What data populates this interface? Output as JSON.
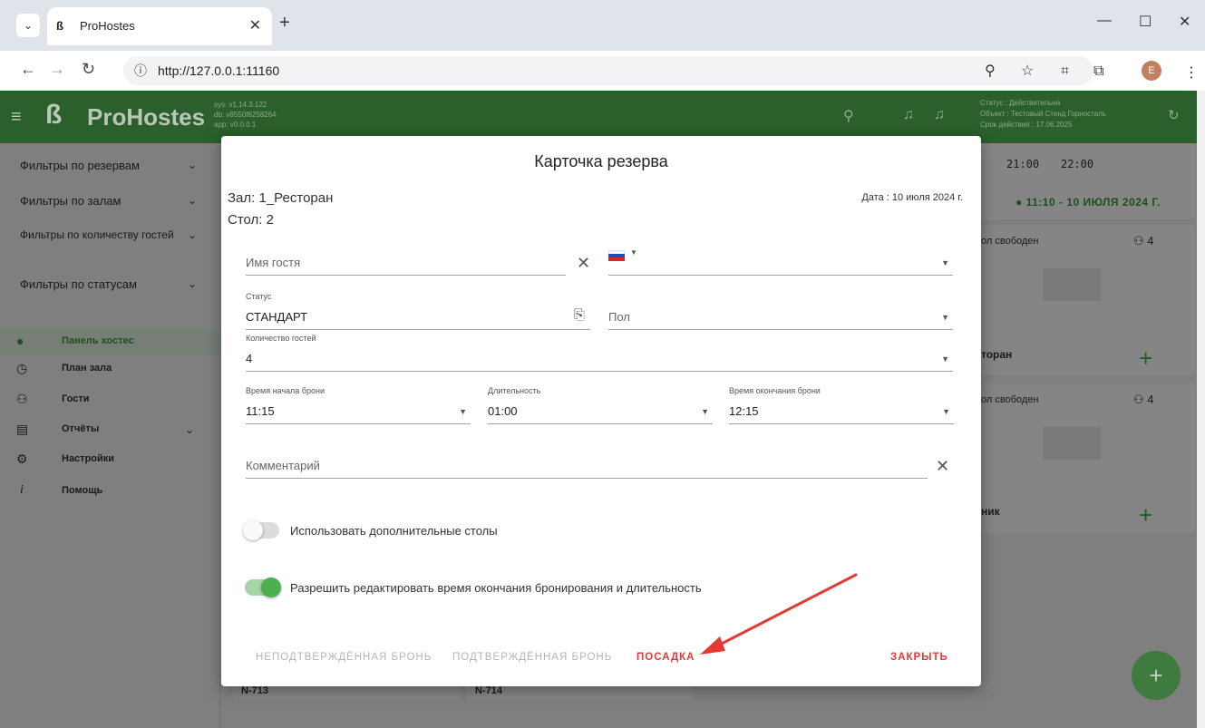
{
  "browser": {
    "tab_title": "ProHostes",
    "url": "http://127.0.0.1:11160",
    "profile_initial": "E"
  },
  "app": {
    "logo_text": "ProHostes",
    "version_lines": [
      "sys: v1.14.3.122",
      "db: v8550f6258264",
      "app: v0.0.0.1"
    ],
    "status_lines": [
      "Статус : Действительна",
      "Объект : Тестовый Стенд Горносталь",
      "Срок действия : 17.06.2025"
    ]
  },
  "sidebar": {
    "filters": [
      {
        "label": "Фильтры по резервам"
      },
      {
        "label": "Фильтры по залам"
      },
      {
        "label": "Фильтры по количеству гостей"
      },
      {
        "label": "Фильтры по статусам"
      }
    ],
    "nav": [
      {
        "label": "Панель хостес",
        "icon": "clock-icon"
      },
      {
        "label": "План зала",
        "icon": "compass-icon"
      },
      {
        "label": "Гости",
        "icon": "people-icon"
      },
      {
        "label": "Отчёты",
        "icon": "report-icon"
      },
      {
        "label": "Настройки",
        "icon": "gear-icon"
      },
      {
        "label": "Помощь",
        "icon": "info-icon"
      }
    ]
  },
  "background": {
    "time1": "21:00",
    "time2": "22:00",
    "current_time": "11:10 - 10 ИЮЛЯ 2024 Г.",
    "card1_status": "ол свободен",
    "card1_count": "4",
    "card1_name": "торан",
    "card2_status": "ол свободен",
    "card2_count": "4",
    "card2_name": "ник",
    "bottom1": "N-713",
    "bottom2": "N-714"
  },
  "modal": {
    "title": "Карточка резерва",
    "hall": "Зал: 1_Ресторан",
    "table": "Стол: 2",
    "date": "Дата : 10 июля 2024 г.",
    "guest_name_placeholder": "Имя гостя",
    "status_caption": "Статус",
    "status_value": "СТАНДАРТ",
    "gender_placeholder": "Пол",
    "guests_caption": "Количество гостей",
    "guests_value": "4",
    "start_caption": "Время начала брони",
    "start_value": "11:15",
    "duration_caption": "Длительность",
    "duration_value": "01:00",
    "end_caption": "Время окончания брони",
    "end_value": "12:15",
    "comment_placeholder": "Комментарий",
    "toggle_extra_label": "Использовать дополнительные столы",
    "toggle_extra_on": false,
    "toggle_edit_label": "Разрешить редактировать время окончания бронирования и длительность",
    "toggle_edit_on": true,
    "btn_unconfirmed": "НЕПОДТВЕРЖДЁННАЯ БРОНЬ",
    "btn_confirmed": "ПОДТВЕРЖДЁННАЯ БРОНЬ",
    "btn_seating": "ПОСАДКА",
    "btn_close": "ЗАКРЫТЬ"
  },
  "colors": {
    "accent_green": "#4caf50",
    "danger_red": "#e53935"
  }
}
